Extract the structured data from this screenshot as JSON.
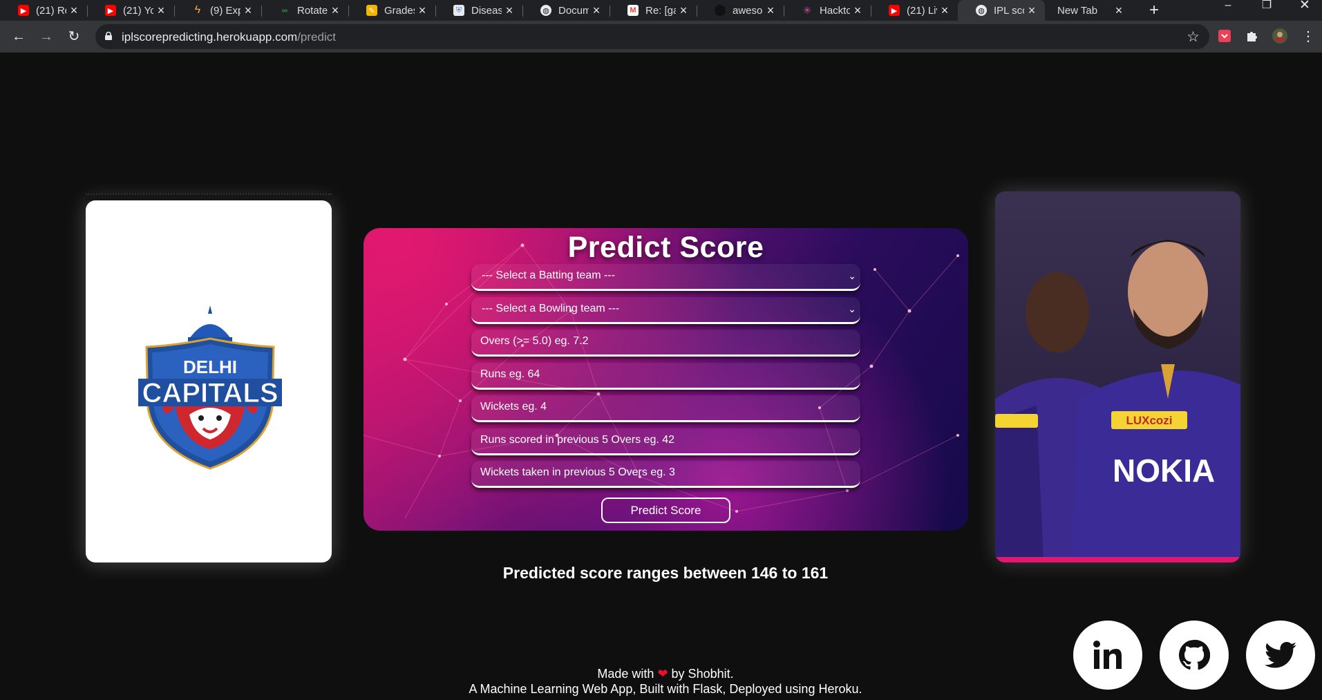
{
  "browser": {
    "tabs": [
      {
        "title": "(21) Re",
        "icon": "youtube-icon",
        "color": "#ff0000"
      },
      {
        "title": "(21) Yo",
        "icon": "youtube-icon",
        "color": "#ff0000"
      },
      {
        "title": "(9) Exp",
        "icon": "bolt-icon",
        "color": "#f6a63a"
      },
      {
        "title": "Rotate",
        "icon": "gfg-icon",
        "color": "#2f8d46"
      },
      {
        "title": "Grades",
        "icon": "pencil-icon",
        "color": "#f4b400"
      },
      {
        "title": "Diseas",
        "icon": "institution-icon",
        "color": "#4a7bd0"
      },
      {
        "title": "Docum",
        "icon": "globe-icon",
        "color": "#9aa0a6"
      },
      {
        "title": "Re: [ga",
        "icon": "gmail-icon",
        "color": "#ea4335"
      },
      {
        "title": "aweso",
        "icon": "github-icon",
        "color": "#ffffff"
      },
      {
        "title": "Hackto",
        "icon": "hacktoberfest-icon",
        "color": "#c64d9d"
      },
      {
        "title": "(21) Liv",
        "icon": "youtube-icon",
        "color": "#ff0000"
      },
      {
        "title": "IPL sco",
        "icon": "globe-icon",
        "color": "#9aa0a6"
      },
      {
        "title": "New Tab",
        "icon": "",
        "color": ""
      }
    ],
    "url_host": "iplscorepredicting.herokuapp.com",
    "url_path": "/predict"
  },
  "form": {
    "title": "Predict Score",
    "batting_placeholder": "--- Select a Batting team ---",
    "bowling_placeholder": "--- Select a Bowling team ---",
    "overs_placeholder": "Overs (>= 5.0) eg. 7.2",
    "runs_placeholder": "Runs eg. 64",
    "wickets_placeholder": "Wickets eg. 4",
    "runs_last5_placeholder": "Runs scored in previous 5 Overs eg. 42",
    "wickets_last5_placeholder": "Wickets taken in previous 5 Overs eg. 3",
    "submit_label": "Predict Score"
  },
  "left_card": {
    "logo_line1": "DELHI",
    "logo_line2": "CAPITALS"
  },
  "right_card": {
    "sponsor": "LUXcozi",
    "jersey_text": "NOKIA"
  },
  "result": {
    "text": "Predicted score ranges between 146 to 161"
  },
  "footer": {
    "made_with": "Made with",
    "by": "by Shobhit.",
    "line2": "A Machine Learning Web App, Built with Flask, Deployed using Heroku."
  },
  "social": [
    "linkedin-icon",
    "github-icon",
    "twitter-icon"
  ]
}
